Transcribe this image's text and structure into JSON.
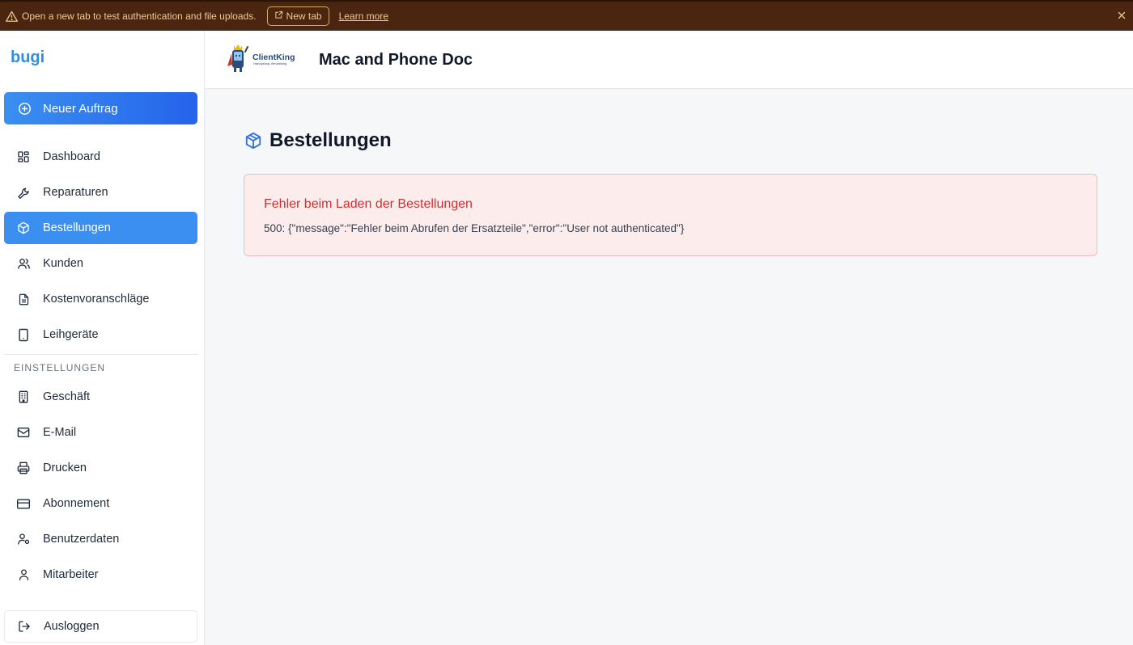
{
  "banner": {
    "message": "Open a new tab to test authentication and file uploads.",
    "new_tab_label": "New tab",
    "learn_more_label": "Learn more"
  },
  "sidebar": {
    "brand": "bugi",
    "new_order_label": "Neuer Auftrag",
    "items": [
      {
        "label": "Dashboard",
        "icon": "dashboard-icon"
      },
      {
        "label": "Reparaturen",
        "icon": "wrench-icon"
      },
      {
        "label": "Bestellungen",
        "icon": "package-icon",
        "active": true
      },
      {
        "label": "Kunden",
        "icon": "users-icon"
      },
      {
        "label": "Kostenvoranschläge",
        "icon": "document-icon"
      },
      {
        "label": "Leihgeräte",
        "icon": "tablet-icon"
      }
    ],
    "settings_title": "EINSTELLUNGEN",
    "settings_items": [
      {
        "label": "Geschäft",
        "icon": "building-icon"
      },
      {
        "label": "E-Mail",
        "icon": "mail-icon"
      },
      {
        "label": "Drucken",
        "icon": "printer-icon"
      },
      {
        "label": "Abonnement",
        "icon": "credit-card-icon"
      },
      {
        "label": "Benutzerdaten",
        "icon": "user-settings-icon"
      },
      {
        "label": "Mitarbeiter",
        "icon": "user-icon"
      }
    ],
    "logout_label": "Ausloggen"
  },
  "header": {
    "logo_text": "ClientKing",
    "logo_subtext": "Handyshop-Verwaltung",
    "shop_name": "Mac and Phone Doc"
  },
  "main": {
    "title": "Bestellungen",
    "error": {
      "title": "Fehler beim Laden der Bestellungen",
      "detail": "500: {\"message\":\"Fehler beim Abrufen der Ersatzteile\",\"error\":\"User not authenticated\"}"
    }
  },
  "colors": {
    "accent": "#3a8ff0",
    "banner_bg": "#4a2510",
    "error_text": "#d32f2f",
    "error_bg": "#fdecec"
  }
}
